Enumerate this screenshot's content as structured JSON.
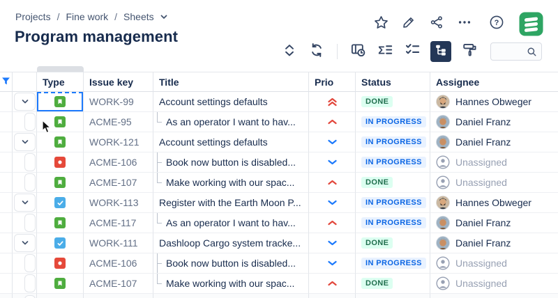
{
  "header": {
    "breadcrumb": {
      "items": [
        "Projects",
        "Fine work",
        "Sheets"
      ],
      "separator": "/"
    },
    "title": "Program management",
    "actions": [
      "favorite",
      "edit",
      "share",
      "more",
      "help",
      "app-logo"
    ]
  },
  "toolbar": {
    "buttons": [
      "expand-collapse",
      "refresh",
      "view-history",
      "aggregate",
      "checklist",
      "hierarchy",
      "formatting"
    ],
    "active_button": "hierarchy",
    "search": {
      "value": "",
      "placeholder": ""
    }
  },
  "table": {
    "columns": [
      {
        "id": "type",
        "label": "Type"
      },
      {
        "id": "key",
        "label": "Issue key"
      },
      {
        "id": "title",
        "label": "Title"
      },
      {
        "id": "prio",
        "label": "Prio"
      },
      {
        "id": "status",
        "label": "Status"
      },
      {
        "id": "assignee",
        "label": "Assignee"
      }
    ],
    "rows": [
      {
        "type": "story",
        "key": "WORK-99",
        "title": "Account settings defaults",
        "level": 0,
        "expanded": true,
        "connector": "none",
        "prio": "highest",
        "status": {
          "label": "DONE",
          "tone": "success"
        },
        "assignee": {
          "name": "Hannes Obweger",
          "avatar": "hannes"
        },
        "focused": true
      },
      {
        "type": "story",
        "key": "ACME-95",
        "title": "As an operator I want to hav...",
        "level": 1,
        "expanded": false,
        "connector": "end",
        "prio": "high",
        "status": {
          "label": "IN PROGRESS",
          "tone": "info"
        },
        "assignee": {
          "name": "Daniel Franz",
          "avatar": "daniel"
        },
        "focused": false
      },
      {
        "type": "story",
        "key": "WORK-121",
        "title": "Account settings defaults",
        "level": 0,
        "expanded": true,
        "connector": "none",
        "prio": "low",
        "status": {
          "label": "IN PROGRESS",
          "tone": "info"
        },
        "assignee": {
          "name": "Daniel Franz",
          "avatar": "daniel"
        },
        "focused": false
      },
      {
        "type": "bug",
        "key": "ACME-106",
        "title": "Book now button is disabled...",
        "level": 1,
        "expanded": false,
        "connector": "mid",
        "prio": "low",
        "status": {
          "label": "IN PROGRESS",
          "tone": "info"
        },
        "assignee": {
          "name": "Unassigned",
          "avatar": "none"
        },
        "focused": false
      },
      {
        "type": "story",
        "key": "ACME-107",
        "title": "Make working with our spac...",
        "level": 1,
        "expanded": false,
        "connector": "end",
        "prio": "high",
        "status": {
          "label": "DONE",
          "tone": "success"
        },
        "assignee": {
          "name": "Unassigned",
          "avatar": "none"
        },
        "focused": false
      },
      {
        "type": "task",
        "key": "WORK-113",
        "title": "Register with the Earth Moon P...",
        "level": 0,
        "expanded": true,
        "connector": "none",
        "prio": "low",
        "status": {
          "label": "IN PROGRESS",
          "tone": "info"
        },
        "assignee": {
          "name": "Hannes Obweger",
          "avatar": "hannes"
        },
        "focused": false
      },
      {
        "type": "story",
        "key": "ACME-117",
        "title": "As an operator I want to hav...",
        "level": 1,
        "expanded": false,
        "connector": "end",
        "prio": "high",
        "status": {
          "label": "IN PROGRESS",
          "tone": "info"
        },
        "assignee": {
          "name": "Daniel Franz",
          "avatar": "daniel"
        },
        "focused": false
      },
      {
        "type": "task",
        "key": "WORK-111",
        "title": "Dashloop Cargo system tracke...",
        "level": 0,
        "expanded": true,
        "connector": "none",
        "prio": "low",
        "status": {
          "label": "DONE",
          "tone": "success"
        },
        "assignee": {
          "name": "Daniel Franz",
          "avatar": "daniel"
        },
        "focused": false
      },
      {
        "type": "bug",
        "key": "ACME-106",
        "title": "Book now button is disabled...",
        "level": 1,
        "expanded": false,
        "connector": "mid",
        "prio": "low",
        "status": {
          "label": "IN PROGRESS",
          "tone": "info"
        },
        "assignee": {
          "name": "Unassigned",
          "avatar": "none"
        },
        "focused": false
      },
      {
        "type": "story",
        "key": "ACME-107",
        "title": "Make working with our spac...",
        "level": 1,
        "expanded": false,
        "connector": "end",
        "prio": "high",
        "status": {
          "label": "DONE",
          "tone": "success"
        },
        "assignee": {
          "name": "Unassigned",
          "avatar": "none"
        },
        "focused": false
      }
    ]
  },
  "colors": {
    "accent": "#1D7AFC",
    "story_icon": "#4FAD3F",
    "bug_icon": "#E5493A",
    "task_icon": "#4BADE8",
    "done_bg": "#DCFFF1",
    "done_text": "#216E4E",
    "inprogress_bg": "#E9F2FF",
    "inprogress_text": "#0C66E4",
    "prio_up": "#E2483D",
    "prio_down": "#1D7AFC",
    "active_tool_bg": "#243757",
    "logo_green": "#2EA563"
  }
}
